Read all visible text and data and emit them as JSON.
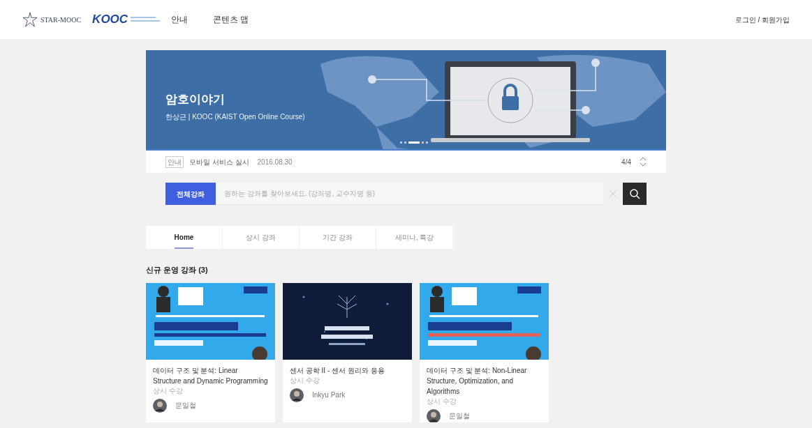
{
  "header": {
    "logos": [
      "STAR-MOOC",
      "KOOC"
    ],
    "nav": [
      {
        "label": "안내"
      },
      {
        "label": "콘텐츠 맵"
      }
    ],
    "auth": "로그인 / 회원가입"
  },
  "hero": {
    "title": "암호이야기",
    "subtitle": "한상근 | KOOC (KAIST Open Online Course)",
    "slides": [
      {
        "selected": false
      },
      {
        "selected": false
      },
      {
        "selected": true
      },
      {
        "selected": false
      },
      {
        "selected": false
      }
    ]
  },
  "notice": {
    "tag": "안내",
    "text": "모바일 서비스 실시",
    "date": "2016.08.30",
    "counter": "4/4"
  },
  "search": {
    "button": "전체강좌",
    "placeholder": "원하는 강좌를 찾아보세요. (강좌명, 교수자명 등)"
  },
  "tabs": [
    {
      "label": "Home",
      "selected": true
    },
    {
      "label": "상시 강좌",
      "selected": false
    },
    {
      "label": "기간 강좌",
      "selected": false
    },
    {
      "label": "세미나, 특강",
      "selected": false
    }
  ],
  "section_title": "신규 운영 강좌 (3)",
  "courses": [
    {
      "kind": "picture",
      "title": "데이터 구조 및 분석: Linear Structure and Dynamic Programming",
      "mode": "상시 수강",
      "instructor": "문일철"
    },
    {
      "kind": "picture",
      "title": "센서 공학 II - 센서 원리와 응용",
      "mode": "상시 수강",
      "instructor": "Inkyu Park"
    },
    {
      "kind": "picture",
      "title": "데이터 구조 및 분석: Non-Linear Structure, Optimization, and Algorithms",
      "mode": "상시 수강",
      "instructor": "문일철"
    }
  ]
}
